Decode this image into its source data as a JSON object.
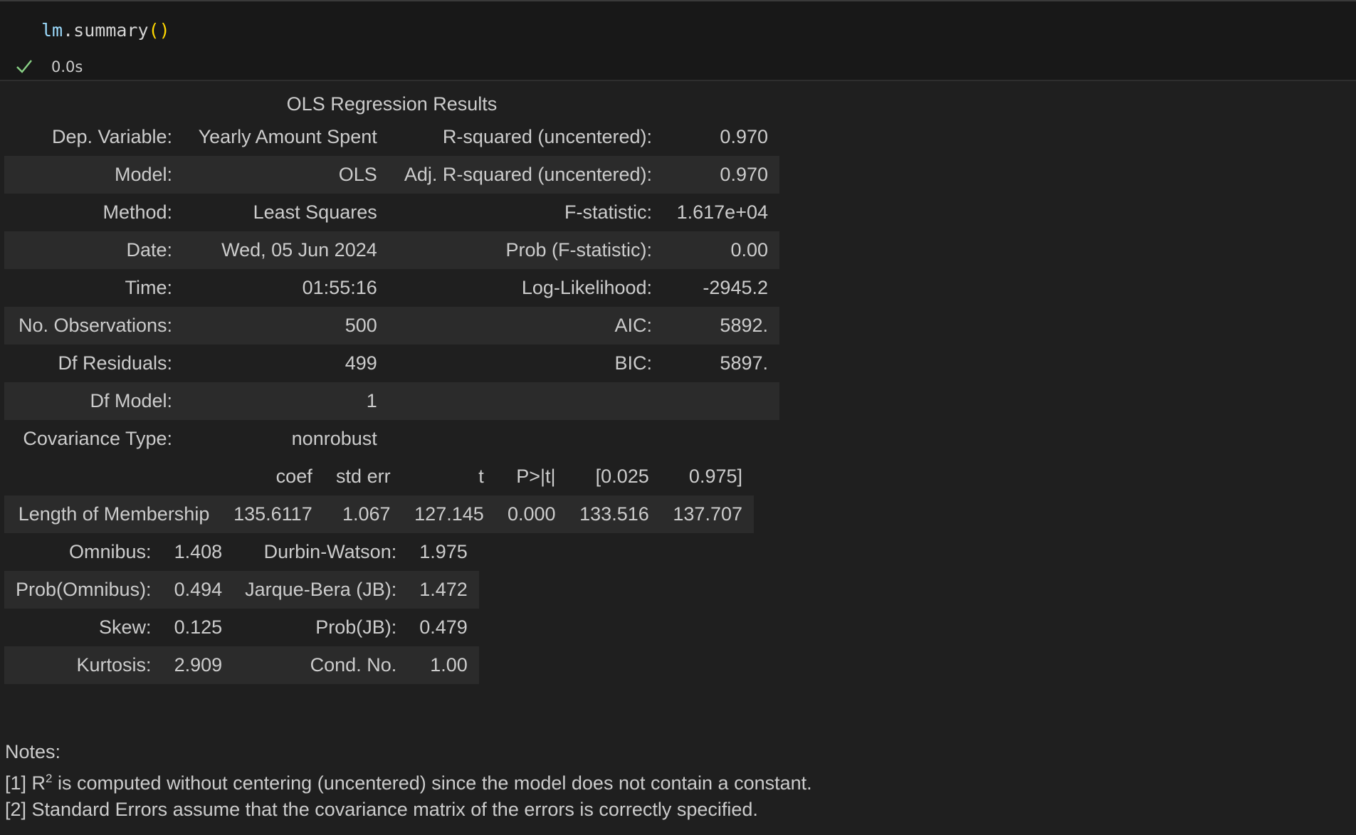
{
  "cell": {
    "code_obj": "lm",
    "code_dot": ".",
    "code_method": "summary",
    "code_parens": "()",
    "status_icon": "check-icon",
    "exec_time": "0.0s"
  },
  "summary": {
    "title": "OLS Regression Results",
    "top_rows": [
      {
        "l1": "Dep. Variable:",
        "v1": "Yearly Amount Spent",
        "l2": "R-squared (uncentered):",
        "v2": "0.970"
      },
      {
        "l1": "Model:",
        "v1": "OLS",
        "l2": "Adj. R-squared (uncentered):",
        "v2": "0.970"
      },
      {
        "l1": "Method:",
        "v1": "Least Squares",
        "l2": "F-statistic:",
        "v2": "1.617e+04"
      },
      {
        "l1": "Date:",
        "v1": "Wed, 05 Jun 2024",
        "l2": "Prob (F-statistic):",
        "v2": "0.00"
      },
      {
        "l1": "Time:",
        "v1": "01:55:16",
        "l2": "Log-Likelihood:",
        "v2": "-2945.2"
      },
      {
        "l1": "No. Observations:",
        "v1": "500",
        "l2": "AIC:",
        "v2": "5892."
      },
      {
        "l1": "Df Residuals:",
        "v1": "499",
        "l2": "BIC:",
        "v2": "5897."
      },
      {
        "l1": "Df Model:",
        "v1": "1",
        "l2": "",
        "v2": ""
      },
      {
        "l1": "Covariance Type:",
        "v1": "nonrobust",
        "l2": "",
        "v2": ""
      }
    ],
    "coef_headers": [
      "coef",
      "std err",
      "t",
      "P>|t|",
      "[0.025",
      "0.975]"
    ],
    "coef_rows": [
      {
        "name": "Length of Membership",
        "coef": "135.6117",
        "std_err": "1.067",
        "t": "127.145",
        "p": "0.000",
        "lo": "133.516",
        "hi": "137.707"
      }
    ],
    "diag_rows": [
      {
        "l1": "Omnibus:",
        "v1": "1.408",
        "l2": "Durbin-Watson:",
        "v2": "1.975"
      },
      {
        "l1": "Prob(Omnibus):",
        "v1": "0.494",
        "l2": "Jarque-Bera (JB):",
        "v2": "1.472"
      },
      {
        "l1": "Skew:",
        "v1": "0.125",
        "l2": "Prob(JB):",
        "v2": "0.479"
      },
      {
        "l1": "Kurtosis:",
        "v1": "2.909",
        "l2": "Cond. No.",
        "v2": "1.00"
      }
    ]
  },
  "notes": {
    "heading": "Notes:",
    "n1_prefix": "[1] R",
    "n1_sup": "2",
    "n1_rest": " is computed without centering (uncentered) since the model does not contain a constant.",
    "n2": "[2] Standard Errors assume that the covariance matrix of the errors is correctly specified."
  }
}
